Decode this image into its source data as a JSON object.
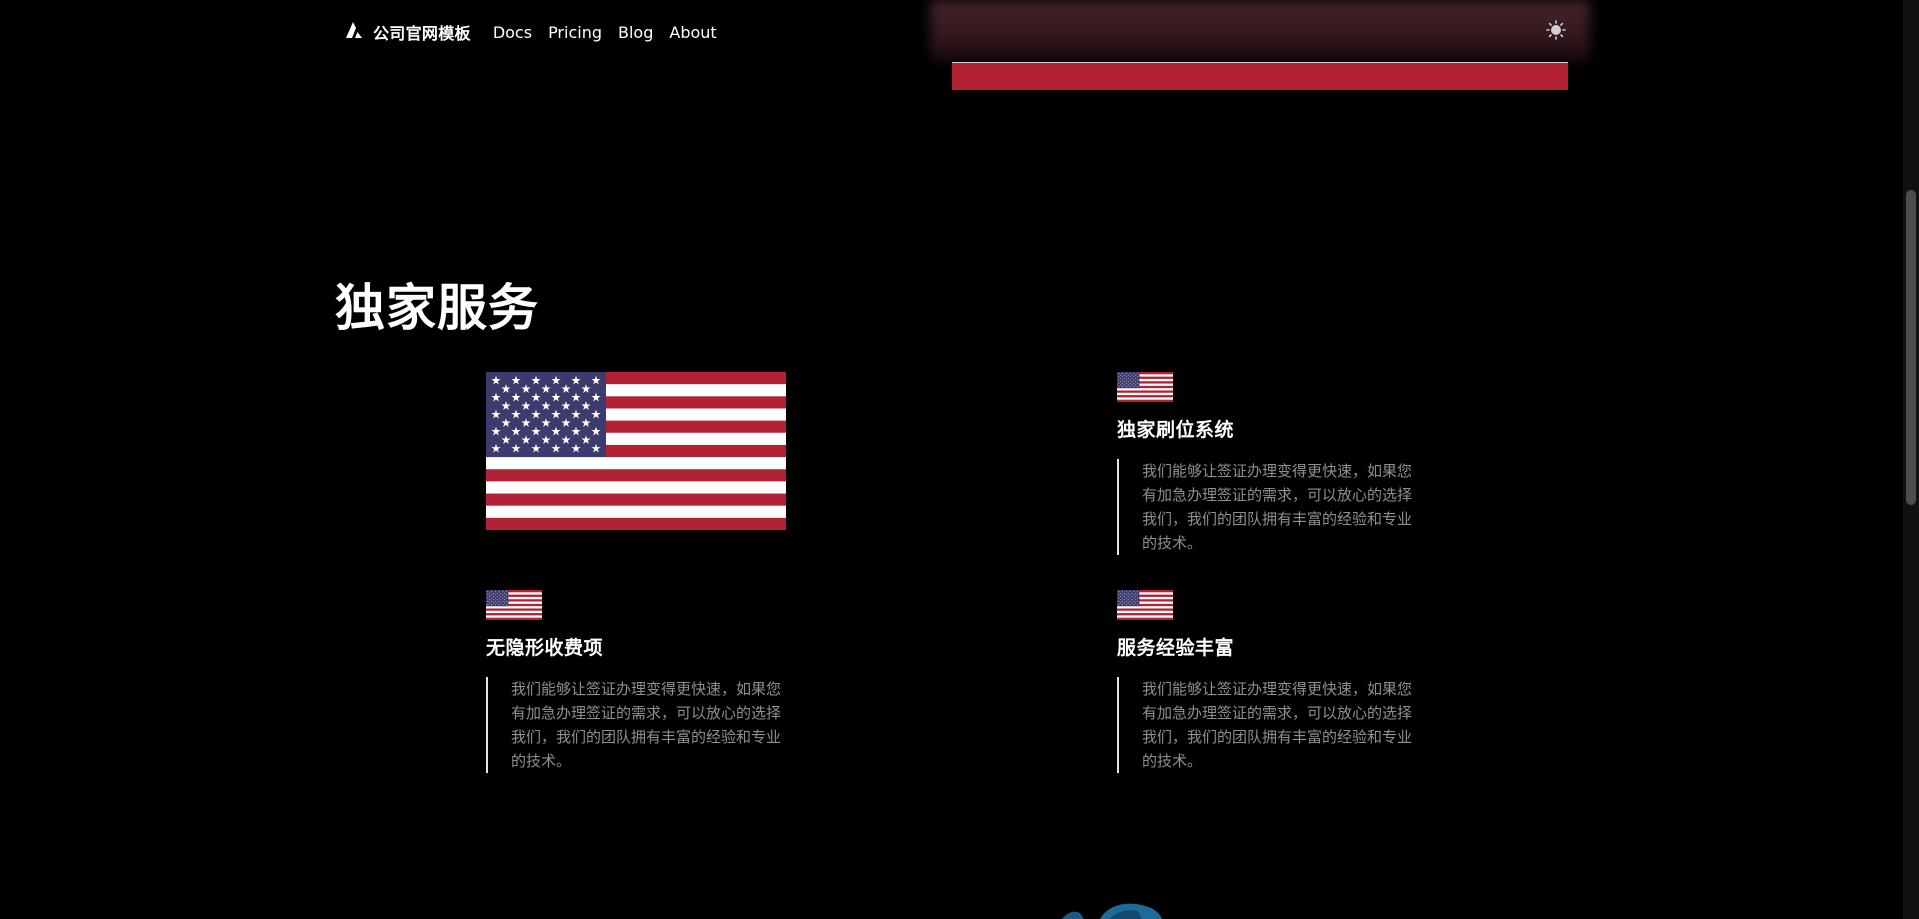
{
  "nav": {
    "brand": "公司官网模板",
    "links": [
      "Docs",
      "Pricing",
      "Blog",
      "About"
    ],
    "theme_toggle_icon": "sun-icon",
    "logo_icon": "triangle-logo-icon"
  },
  "section": {
    "title": "独家服务",
    "features": [
      {
        "title": "独家刷位系统",
        "desc": "我们能够让签证办理变得更快速，如果您有加急办理签证的需求，可以放心的选择我们，我们的团队拥有丰富的经验和专业的技术。",
        "icon": "us-flag-icon"
      },
      {
        "title": "无隐形收费项",
        "desc": "我们能够让签证办理变得更快速，如果您有加急办理签证的需求，可以放心的选择我们，我们的团队拥有丰富的经验和专业的技术。",
        "icon": "us-flag-icon"
      },
      {
        "title": "服务经验丰富",
        "desc": "我们能够让签证办理变得更快速，如果您有加急办理签证的需求，可以放心的选择我们，我们的团队拥有丰富的经验和专业的技术。",
        "icon": "us-flag-icon"
      }
    ],
    "hero_image_icon": "us-flag-icon"
  },
  "colors": {
    "background": "#000000",
    "flag_red": "#b22234",
    "flag_blue": "#3c3b6e",
    "desc_text": "#8f8f8f"
  }
}
